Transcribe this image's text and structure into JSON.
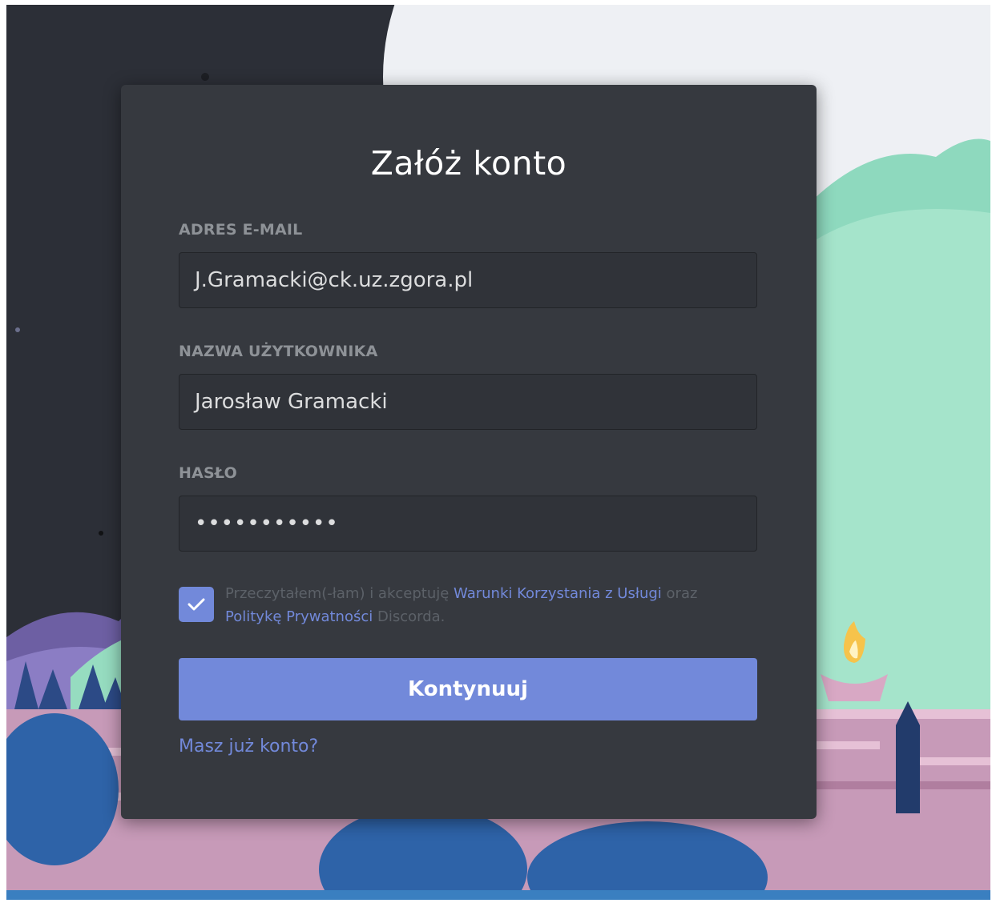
{
  "form": {
    "title": "Załóż konto",
    "email_label": "ADRES E-MAIL",
    "email_value": "J.Gramacki@ck.uz.zgora.pl",
    "username_label": "NAZWA UŻYTKOWNIKA",
    "username_value": "Jarosław Gramacki",
    "password_label": "HASŁO",
    "password_value": "•••••••••••",
    "terms_checked": true,
    "terms_text_1": "Przeczytałem(-łam) i akceptuję ",
    "terms_link_tos": "Warunki Korzystania z Usługi",
    "terms_text_2": " oraz ",
    "terms_link_privacy": "Politykę Prywatności",
    "terms_text_3": " Discorda.",
    "continue_label": "Kontynuuj",
    "login_link": "Masz już konto?"
  },
  "colors": {
    "modal_bg": "#36393f",
    "input_bg": "#303339",
    "accent": "#7289da",
    "label": "#8e9297",
    "night_sky": "#2c2f37",
    "moon": "#f1f1f5",
    "hills": "#9fe0c4",
    "wall": "#c08fb0"
  },
  "icons": {
    "checkbox": "check-icon"
  }
}
